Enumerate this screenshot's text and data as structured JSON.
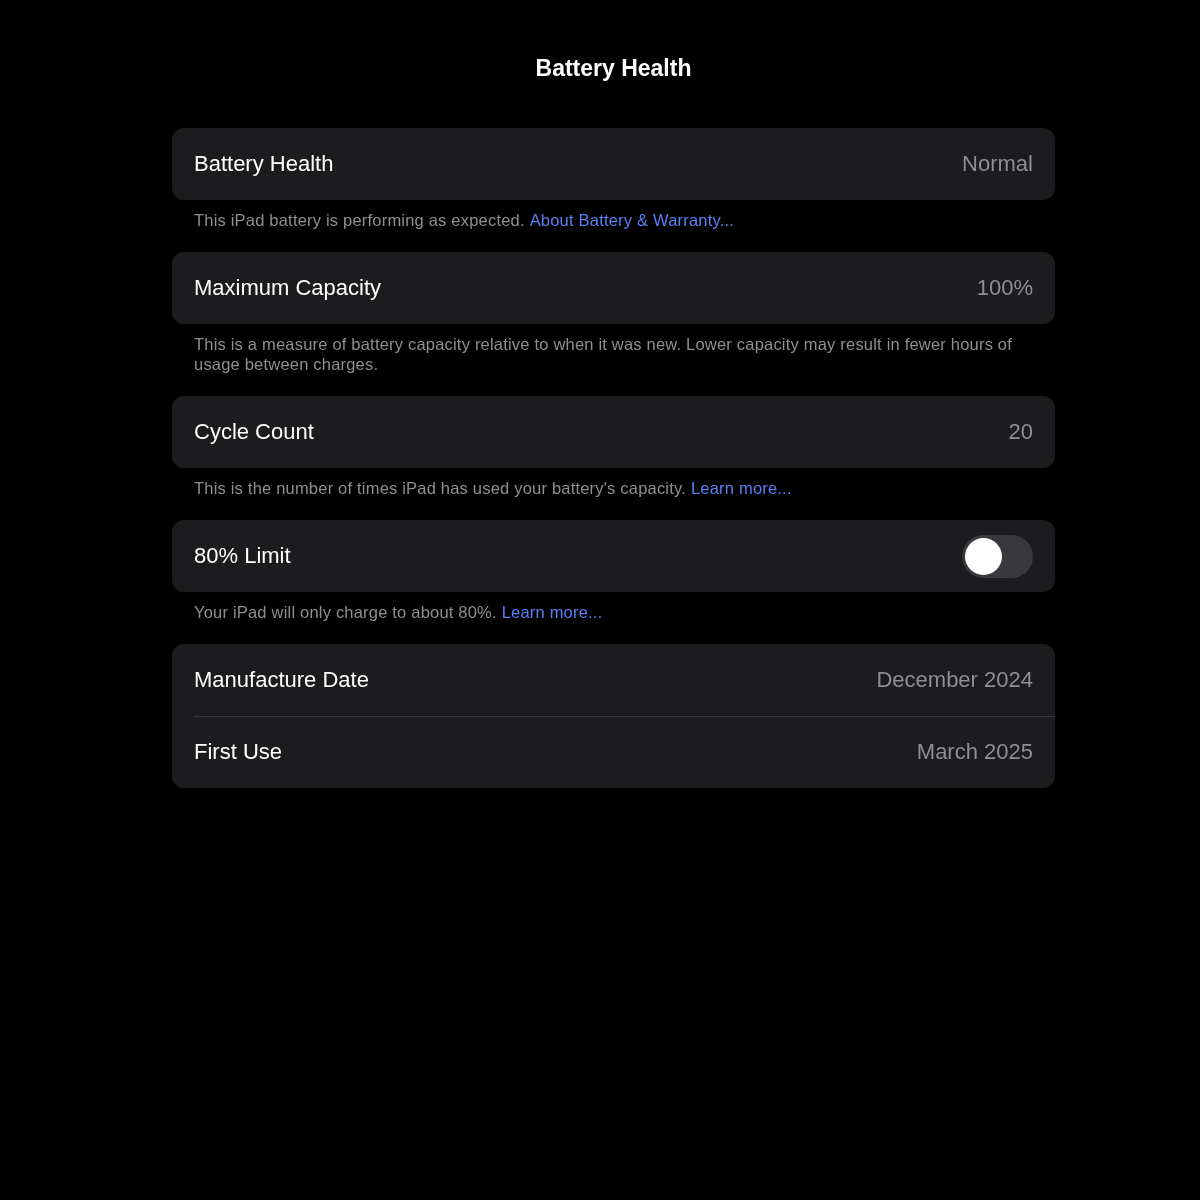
{
  "title": "Battery Health",
  "sections": [
    {
      "rows": [
        {
          "kind": "value",
          "label": "Battery Health",
          "value": "Normal"
        }
      ],
      "footer": {
        "text": "This iPad battery is performing as expected.",
        "link": "About Battery & Warranty..."
      }
    },
    {
      "rows": [
        {
          "kind": "value",
          "label": "Maximum Capacity",
          "value": "100%"
        }
      ],
      "footer": {
        "text": "This is a measure of battery capacity relative to when it was new. Lower capacity may result in fewer hours of usage between charges."
      }
    },
    {
      "rows": [
        {
          "kind": "value",
          "label": "Cycle Count",
          "value": "20"
        }
      ],
      "footer": {
        "text": "This is the number of times iPad has used your battery's capacity.",
        "link": "Learn more..."
      }
    },
    {
      "rows": [
        {
          "kind": "toggle",
          "label": "80% Limit",
          "on": false
        }
      ],
      "footer": {
        "text": "Your iPad will only charge to about 80%.",
        "link": "Learn more..."
      }
    },
    {
      "rows": [
        {
          "kind": "value",
          "label": "Manufacture Date",
          "value": "December 2024"
        },
        {
          "kind": "value",
          "label": "First Use",
          "value": "March 2025"
        }
      ]
    }
  ]
}
